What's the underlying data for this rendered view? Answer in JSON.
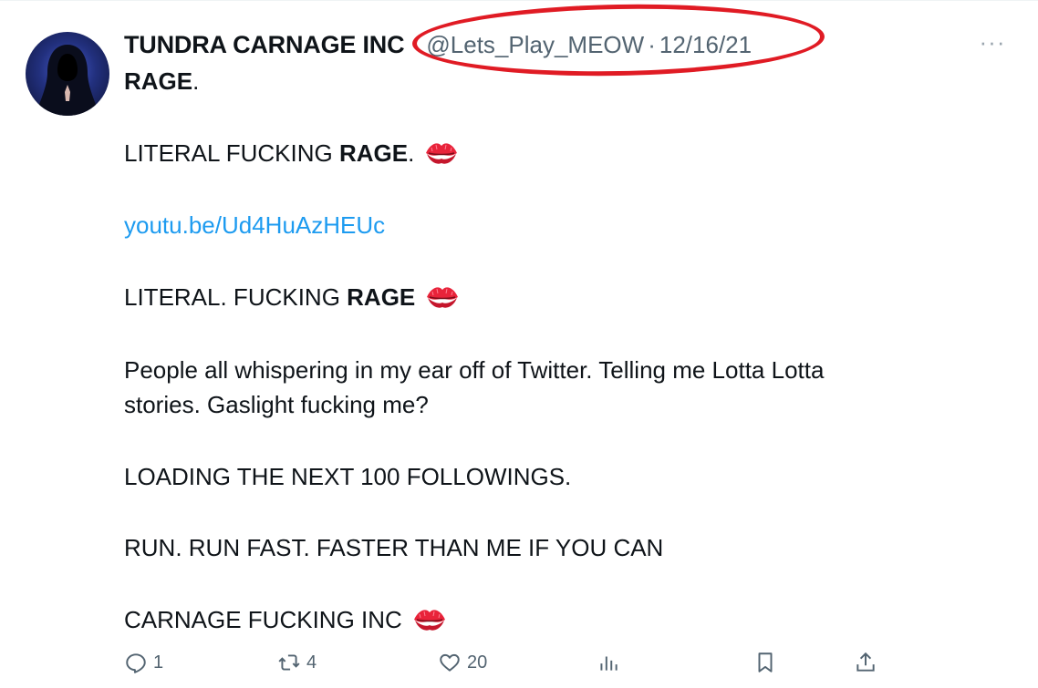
{
  "tweet": {
    "display_name": "TUNDRA CARNAGE INC",
    "handle": "@Lets_Play_MEOW",
    "separator": "·",
    "date": "12/16/21",
    "more_glyph": "···",
    "lines": {
      "l1_bold": "RAGE",
      "l1_rest": ".",
      "l2_plain": "LITERAL FUCKING ",
      "l2_bold": "RAGE",
      "l2_rest": ".",
      "link": "youtu.be/Ud4HuAzHEUc",
      "l3_plain": "LITERAL. FUCKING ",
      "l3_bold": "RAGE",
      "l4a": "People all whispering in my ear off of Twitter.  Telling me Lotta Lotta",
      "l4b": "stories.  Gaslight fucking me?",
      "l5": "LOADING THE NEXT 100 FOLLOWINGS.",
      "l6": "RUN. RUN FAST. FASTER THAN ME IF YOU CAN",
      "l7": "CARNAGE FUCKING INC"
    }
  },
  "actions": {
    "reply_count": "1",
    "retweet_count": "4",
    "like_count": "20"
  },
  "icons": {
    "kiss": "kiss-mark-icon",
    "reply": "reply-icon",
    "retweet": "retweet-icon",
    "like": "heart-icon",
    "views": "views-icon",
    "bookmark": "bookmark-icon",
    "share": "share-icon"
  },
  "colors": {
    "link": "#1d9bf0",
    "muted": "#536471",
    "highlight": "#e01b24"
  }
}
